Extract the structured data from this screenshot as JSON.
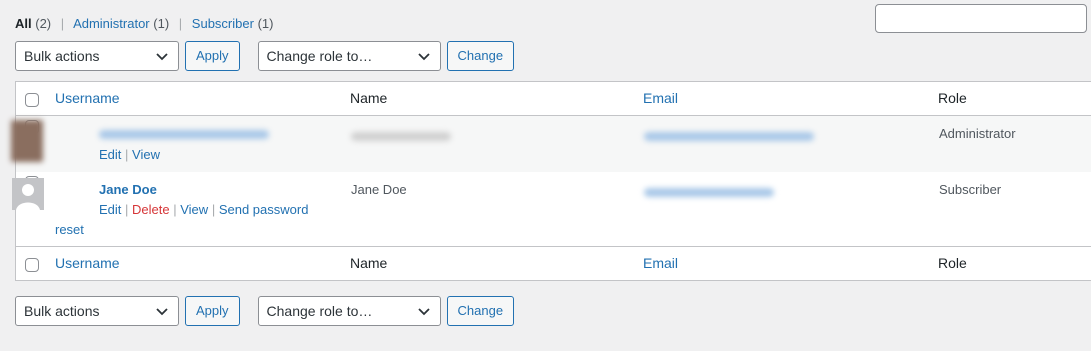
{
  "views": {
    "all_label": "All",
    "all_count": "(2)",
    "admin_label": "Administrator",
    "admin_count": "(1)",
    "sub_label": "Subscriber",
    "sub_count": "(1)",
    "separator": "|"
  },
  "search": {
    "value": ""
  },
  "tablenav_top": {
    "bulk_actions": "Bulk actions",
    "apply": "Apply",
    "change_role": "Change role to…",
    "change": "Change"
  },
  "tablenav_bottom": {
    "bulk_actions": "Bulk actions",
    "apply": "Apply",
    "change_role": "Change role to…",
    "change": "Change"
  },
  "columns": {
    "username": "Username",
    "name": "Name",
    "email": "Email",
    "role": "Role"
  },
  "rows": [
    {
      "username": "",
      "name": "",
      "email": "",
      "role": "Administrator",
      "actions": {
        "edit": "Edit",
        "view": "View"
      }
    },
    {
      "username": "Jane Doe",
      "name": "Jane Doe",
      "email": "",
      "role": "Subscriber",
      "actions": {
        "edit": "Edit",
        "delete": "Delete",
        "view": "View",
        "send_password": "Send password",
        "reset": "reset"
      }
    }
  ],
  "colors": {
    "link": "#2271b1",
    "delete": "#d63638",
    "background": "#f0f0f1"
  }
}
